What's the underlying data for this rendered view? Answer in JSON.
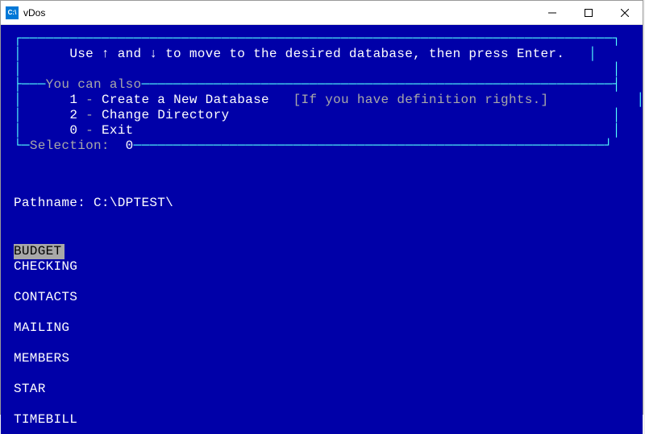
{
  "window": {
    "title": "vDos"
  },
  "instruction": "Use ↑ and ↓ to move to the desired database, then press Enter.",
  "options_header": "You can also",
  "options": [
    {
      "num": "1",
      "label": "Create a New Database",
      "note": "[If you have definition rights.]"
    },
    {
      "num": "2",
      "label": "Change Directory",
      "note": ""
    },
    {
      "num": "0",
      "label": "Exit",
      "note": ""
    }
  ],
  "selection_label": "Selection:",
  "selection_value": "0",
  "pathname_label": "Pathname:",
  "pathname_value": "C:\\DPTEST\\",
  "databases": [
    {
      "name": "BUDGET",
      "selected": true
    },
    {
      "name": "CHECKING",
      "selected": false
    },
    {
      "name": "CONTACTS",
      "selected": false
    },
    {
      "name": "MAILING",
      "selected": false
    },
    {
      "name": "MEMBERS",
      "selected": false
    },
    {
      "name": "STAR",
      "selected": false
    },
    {
      "name": "TIMEBILL",
      "selected": false
    }
  ],
  "colors": {
    "terminal_bg": "#0000a8",
    "text_dim": "#a8a8a8",
    "text_bright": "#ffffff",
    "border_cyan": "#54ffff",
    "highlight_bg": "#a8a8a8",
    "highlight_fg": "#000000"
  }
}
